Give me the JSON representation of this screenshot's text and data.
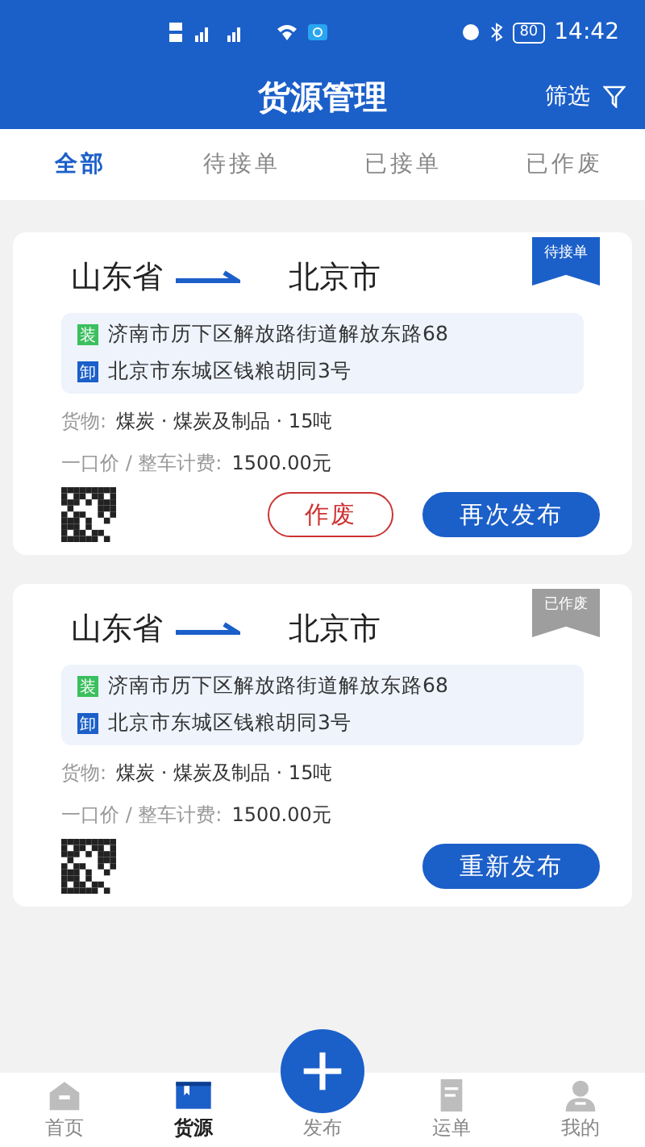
{
  "status_bar": {
    "time": "14:42",
    "battery": "80"
  },
  "header": {
    "title": "货源管理",
    "filter": "筛选"
  },
  "tabs": [
    {
      "label": "全部",
      "selected": true
    },
    {
      "label": "待接单",
      "selected": false
    },
    {
      "label": "已接单",
      "selected": false
    },
    {
      "label": "已作废",
      "selected": false
    }
  ],
  "cards": [
    {
      "from": "山东省",
      "to": "北京市",
      "badge": {
        "text": "待接单",
        "kind": "active"
      },
      "load": {
        "tag": "装",
        "address": "济南市历下区解放路街道解放东路68"
      },
      "unload": {
        "tag": "卸",
        "address": "北京市东城区钱粮胡同3号"
      },
      "cargo_label": "货物:",
      "cargo": "煤炭 · 煤炭及制品 · 15吨",
      "price_label": "一口价 / 整车计费:",
      "price": "1500.00元",
      "buttons": [
        {
          "label": "作废",
          "kind": "outline"
        },
        {
          "label": "再次发布",
          "kind": "filled"
        }
      ]
    },
    {
      "from": "山东省",
      "to": "北京市",
      "badge": {
        "text": "已作废",
        "kind": "void"
      },
      "load": {
        "tag": "装",
        "address": "济南市历下区解放路街道解放东路68"
      },
      "unload": {
        "tag": "卸",
        "address": "北京市东城区钱粮胡同3号"
      },
      "cargo_label": "货物:",
      "cargo": "煤炭 · 煤炭及制品 · 15吨",
      "price_label": "一口价 / 整车计费:",
      "price": "1500.00元",
      "buttons": [
        {
          "label": "重新发布",
          "kind": "filled"
        }
      ]
    }
  ],
  "nav": [
    {
      "label": "首页",
      "kind": "home",
      "selected": false
    },
    {
      "label": "货源",
      "kind": "cargo",
      "selected": true
    },
    {
      "label": "发布",
      "kind": "publish",
      "selected": false
    },
    {
      "label": "运单",
      "kind": "orders",
      "selected": false
    },
    {
      "label": "我的",
      "kind": "me",
      "selected": false
    }
  ]
}
